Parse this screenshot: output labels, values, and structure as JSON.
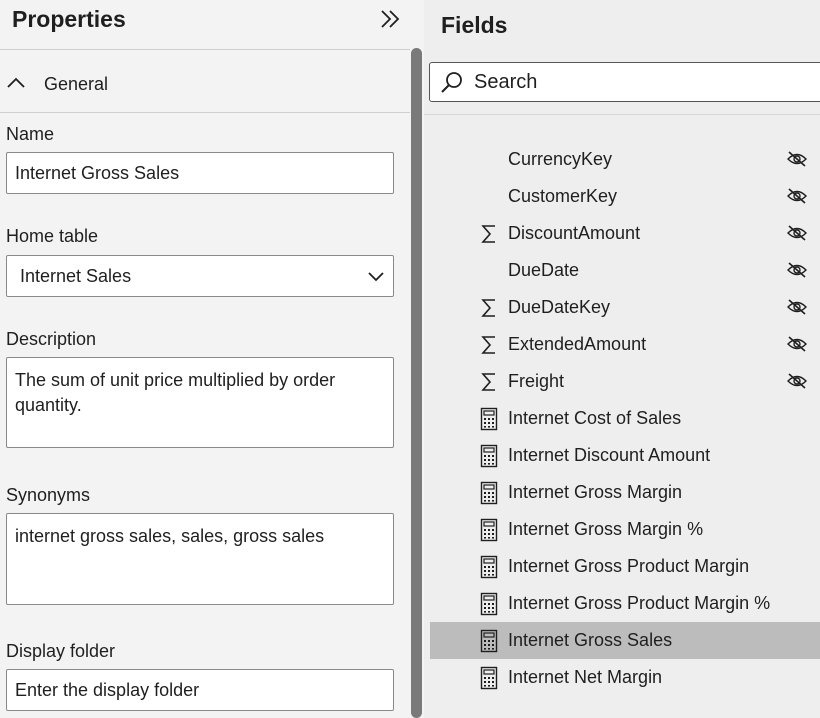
{
  "properties": {
    "title": "Properties",
    "section": "General",
    "name_label": "Name",
    "name_value": "Internet Gross Sales",
    "home_table_label": "Home table",
    "home_table_value": "Internet Sales",
    "description_label": "Description",
    "description_value": "The sum of unit price multiplied by order quantity.",
    "synonyms_label": "Synonyms",
    "synonyms_value": "internet gross sales, sales, gross sales",
    "display_folder_label": "Display folder",
    "display_folder_placeholder": "Enter the display folder"
  },
  "fields": {
    "title": "Fields",
    "search_placeholder": "Search",
    "selected_color": "#bcbcbc",
    "items": [
      {
        "label": "CurrencyKey",
        "icon": "none",
        "hidden": true
      },
      {
        "label": "CustomerKey",
        "icon": "none",
        "hidden": true
      },
      {
        "label": "DiscountAmount",
        "icon": "sigma",
        "hidden": true
      },
      {
        "label": "DueDate",
        "icon": "none",
        "hidden": true
      },
      {
        "label": "DueDateKey",
        "icon": "sigma",
        "hidden": true
      },
      {
        "label": "ExtendedAmount",
        "icon": "sigma",
        "hidden": true
      },
      {
        "label": "Freight",
        "icon": "sigma",
        "hidden": true
      },
      {
        "label": "Internet Cost of Sales",
        "icon": "calculator",
        "hidden": false
      },
      {
        "label": "Internet Discount Amount",
        "icon": "calculator",
        "hidden": false
      },
      {
        "label": "Internet Gross Margin",
        "icon": "calculator",
        "hidden": false
      },
      {
        "label": "Internet Gross Margin %",
        "icon": "calculator",
        "hidden": false
      },
      {
        "label": "Internet Gross Product Margin",
        "icon": "calculator",
        "hidden": false
      },
      {
        "label": "Internet Gross Product Margin %",
        "icon": "calculator",
        "hidden": false
      },
      {
        "label": "Internet Gross Sales",
        "icon": "calculator",
        "hidden": false,
        "selected": true
      },
      {
        "label": "Internet Net Margin",
        "icon": "calculator",
        "hidden": false
      }
    ]
  }
}
